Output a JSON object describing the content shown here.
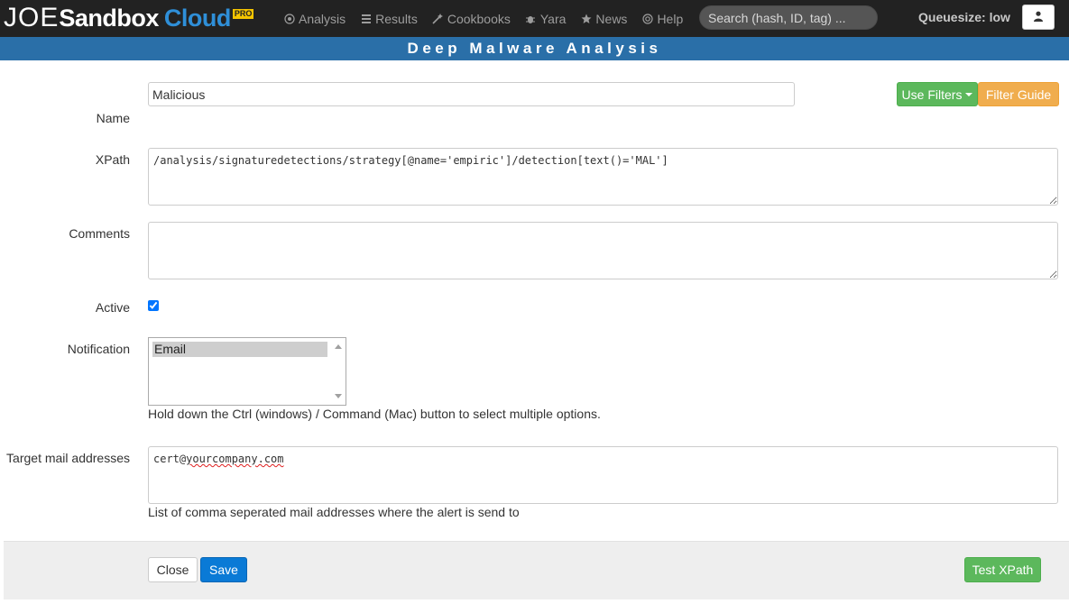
{
  "brand": {
    "part1": "JOE",
    "part2": "Sandbox",
    "part3": "Cloud",
    "badge": "PRO"
  },
  "nav": {
    "items": [
      {
        "label": "Analysis",
        "icon": "target-icon"
      },
      {
        "label": "Results",
        "icon": "list-icon"
      },
      {
        "label": "Cookbooks",
        "icon": "wand-icon"
      },
      {
        "label": "Yara",
        "icon": "bug-icon"
      },
      {
        "label": "News",
        "icon": "star-icon"
      },
      {
        "label": "Help",
        "icon": "lifebuoy-icon"
      }
    ],
    "search_placeholder": "Search (hash, ID, tag) ...",
    "queuesize": "Queuesize: low",
    "user_icon": "user-icon"
  },
  "banner": {
    "title": "Deep Malware Analysis"
  },
  "form": {
    "name_label": "Name",
    "name_value": "Malicious",
    "use_filters_label": "Use Filters",
    "filter_guide_label": "Filter Guide",
    "xpath_label": "XPath",
    "xpath_value": "/analysis/signaturedetections/strategy[@name='empiric']/detection[text()='MAL']",
    "comments_label": "Comments",
    "comments_value": "",
    "active_label": "Active",
    "active_checked": true,
    "notification_label": "Notification",
    "notification_options": [
      "Email"
    ],
    "notification_help": "Hold down the Ctrl (windows) / Command (Mac) button to select multiple options.",
    "target_label": "Target mail addresses",
    "target_value_prefix": "cert@",
    "target_value_domain": "yourcompany.com",
    "target_help": "List of comma seperated mail addresses where the alert is send to"
  },
  "footer": {
    "close_label": "Close",
    "save_label": "Save",
    "test_label": "Test XPath"
  },
  "colors": {
    "navbar_bg": "#222222",
    "banner_bg": "#2a6fa8",
    "brand_cloud": "#2f8fd8",
    "success": "#5cb85c",
    "warning": "#f0ad4e",
    "primary": "#0a7ad6"
  }
}
